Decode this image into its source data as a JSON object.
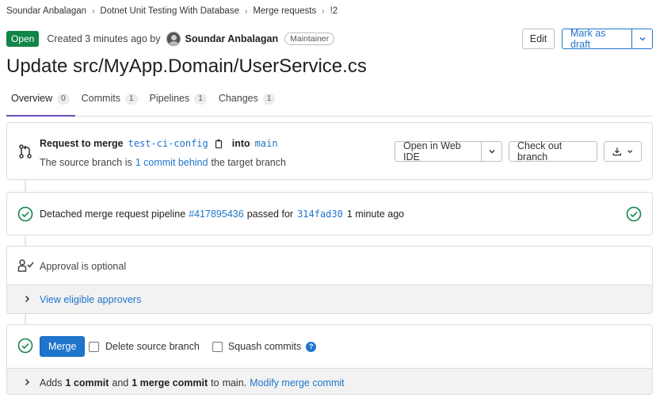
{
  "breadcrumb": [
    "Soundar Anbalagan",
    "Dotnet Unit Testing With Database",
    "Merge requests",
    "!2"
  ],
  "header": {
    "status": "Open",
    "created": "Created 3 minutes ago by",
    "author": "Soundar Anbalagan",
    "role": "Maintainer",
    "edit_label": "Edit",
    "draft_label": "Mark as draft"
  },
  "title": "Update src/MyApp.Domain/UserService.cs",
  "tabs": [
    {
      "label": "Overview",
      "count": "0"
    },
    {
      "label": "Commits",
      "count": "1"
    },
    {
      "label": "Pipelines",
      "count": "1"
    },
    {
      "label": "Changes",
      "count": "1"
    }
  ],
  "merge_request": {
    "prefix": "Request to merge",
    "source": "test-ci-config",
    "into": "into",
    "target": "main",
    "behind_pre": "The source branch is",
    "behind_link": "1 commit behind",
    "behind_post": "the target branch",
    "web_ide_label": "Open in Web IDE",
    "checkout_label": "Check out branch"
  },
  "pipeline": {
    "pre": "Detached merge request pipeline",
    "id": "#417895436",
    "mid": "passed for",
    "sha": "314fad30",
    "post": "1 minute ago"
  },
  "approval": {
    "text": "Approval is optional",
    "approvers_link": "View eligible approvers"
  },
  "merge": {
    "button": "Merge",
    "delete_source": "Delete source branch",
    "squash": "Squash commits",
    "help": "?",
    "adds": "Adds",
    "one_commit": "1 commit",
    "and": "and",
    "merge_commit": "1 merge commit",
    "to": "to",
    "branch": "main.",
    "modify": "Modify merge commit"
  },
  "colors": {
    "open_badge": "#108548",
    "link": "#1f75cb",
    "success": "#108548",
    "tab_active": "#6b4fbb"
  }
}
